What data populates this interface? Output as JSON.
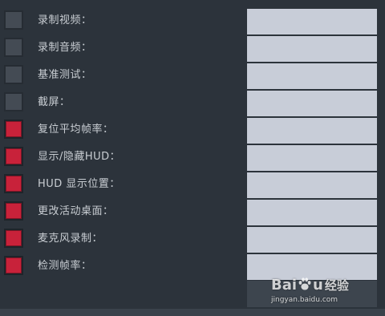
{
  "settings": {
    "rows": [
      {
        "label": "录制视频：",
        "checked": false
      },
      {
        "label": "录制音频：",
        "checked": false
      },
      {
        "label": "基准测试：",
        "checked": false
      },
      {
        "label": "截屏：",
        "checked": false
      },
      {
        "label": "复位平均帧率：",
        "checked": true
      },
      {
        "label": "显示/隐藏HUD：",
        "checked": true
      },
      {
        "label": "HUD 显示位置：",
        "checked": true
      },
      {
        "label": "更改活动桌面：",
        "checked": true
      },
      {
        "label": "麦克风录制：",
        "checked": true
      },
      {
        "label": "检测帧率：",
        "checked": true
      }
    ]
  },
  "watermark": {
    "logo_text_left": "Bai",
    "logo_text_right": "u",
    "logo_suffix": "经验",
    "url": "jingyan.baidu.com"
  },
  "colors": {
    "background": "#2c333b",
    "checkbox_unchecked": "#444b54",
    "checkbox_checked": "#c8223a",
    "label_text": "#c9ced3",
    "hotkey_field": "#c8cdd8"
  }
}
